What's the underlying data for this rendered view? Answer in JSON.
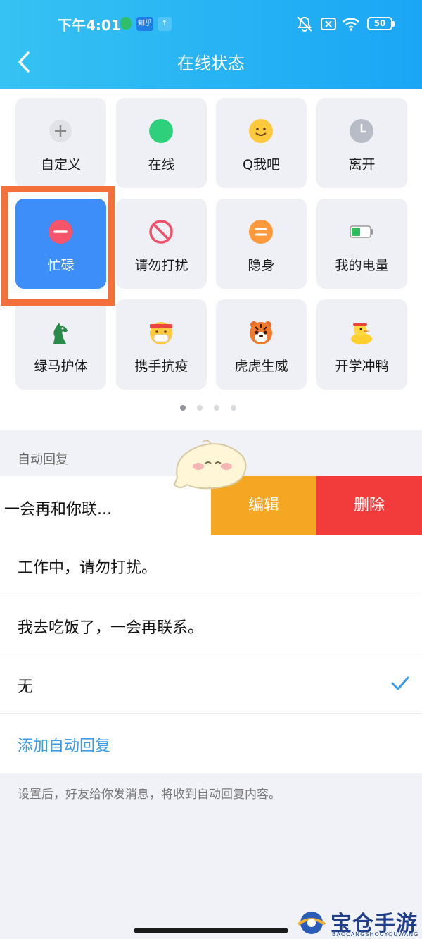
{
  "status_bar": {
    "time": "下午4:01",
    "zhihu_badge": "知乎",
    "upload_badge": "↑",
    "battery": "50"
  },
  "header": {
    "title": "在线状态"
  },
  "statuses": [
    {
      "label": "自定义",
      "icon": "plus-icon"
    },
    {
      "label": "在线",
      "icon": "online-dot-icon"
    },
    {
      "label": "Q我吧",
      "icon": "smile-icon"
    },
    {
      "label": "离开",
      "icon": "clock-icon"
    },
    {
      "label": "忙碌",
      "icon": "busy-minus-icon",
      "selected": true
    },
    {
      "label": "请勿打扰",
      "icon": "no-entry-icon"
    },
    {
      "label": "隐身",
      "icon": "invisible-equals-icon"
    },
    {
      "label": "我的电量",
      "icon": "battery-icon"
    },
    {
      "label": "绿马护体",
      "icon": "green-horse-icon"
    },
    {
      "label": "携手抗疫",
      "icon": "mask-face-icon"
    },
    {
      "label": "虎虎生威",
      "icon": "tiger-icon"
    },
    {
      "label": "开学冲鸭",
      "icon": "duck-icon"
    }
  ],
  "pagination": {
    "pages": 4,
    "current": 1
  },
  "auto_reply": {
    "section_label": "自动回复",
    "swiped_item": "一会再和你联...",
    "edit_label": "编辑",
    "delete_label": "删除",
    "items": [
      {
        "text": "工作中，请勿打扰。"
      },
      {
        "text": "我去吃饭了，一会再联系。"
      },
      {
        "text": "无",
        "checked": true
      }
    ],
    "add_label": "添加自动回复",
    "footnote": "设置后，好友给你发消息，将收到自动回复内容。"
  },
  "watermark": {
    "text": "宝仓手游网",
    "sub": "BAOCANGSHOUYOUWANG"
  },
  "colors": {
    "header_start": "#36c2f2",
    "header_end": "#1aa6f5",
    "selected_tile": "#3d8ef8",
    "highlight": "#f3703a",
    "edit": "#f5a623",
    "delete": "#f23c3c",
    "link": "#3d9be8"
  }
}
